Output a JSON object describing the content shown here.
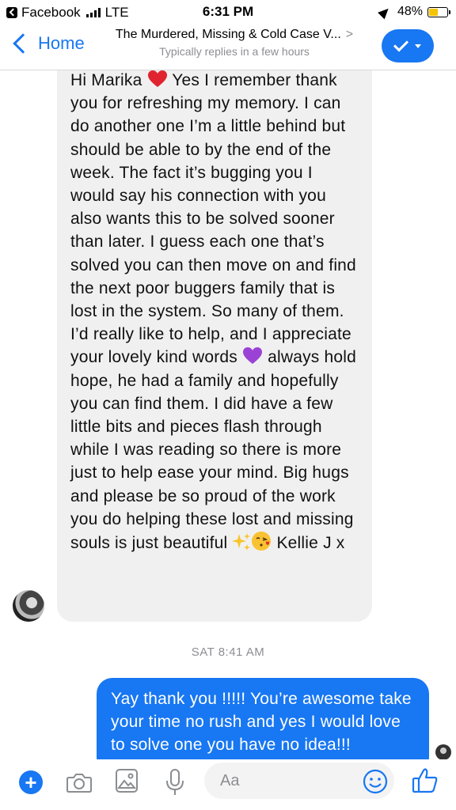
{
  "status_bar": {
    "back_app": "Facebook",
    "network": "LTE",
    "time": "6:31 PM",
    "battery_percent": "48%",
    "battery_level": 0.48
  },
  "header": {
    "back_label": "Home",
    "title": "The Murdered, Missing & Cold Case V...",
    "title_arrow": ">",
    "subtitle": "Typically replies in a few hours"
  },
  "messages": {
    "incoming_text_1": "Hi Marika",
    "incoming_text_2": "Yes I remember thank you for refreshing my memory. I can do another one I’m a little behind but should be able to by the end of the week. The fact it’s bugging you I would say his connection with you also wants this to be solved sooner than later. I guess each one that’s solved you can then move on and find the next poor buggers family that is lost in the system. So many of them. I’d really like to help, and I appreciate your lovely kind words",
    "incoming_text_3": "always hold hope, he had a family and hopefully you can find them. I did have a few little bits and pieces flash through while I was reading so there is more just to help ease your mind. Big hugs and please be so proud of the work you do helping these lost and missing souls is just beautiful",
    "incoming_text_4": "Kellie J x",
    "timestamp": "SAT 8:41 AM",
    "outgoing_text": "Yay thank you !!!!! You’re awesome take your time no rush and yes I would love to solve one you have no idea!!!"
  },
  "composer": {
    "placeholder": "Aa"
  },
  "colors": {
    "accent": "#1877f2",
    "incoming_bubble": "#f1f0f0",
    "heart": "#e0242f",
    "purple_heart": "#9b42d6"
  },
  "icons": [
    "add-icon",
    "camera-icon",
    "gallery-icon",
    "microphone-icon",
    "emoji-icon",
    "thumbs-up-icon",
    "checkmark-icon",
    "heart-emoji",
    "purple-heart-emoji",
    "sparkles-emoji",
    "kiss-face-emoji"
  ]
}
